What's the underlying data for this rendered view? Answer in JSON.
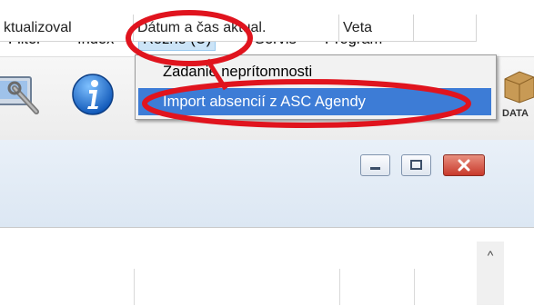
{
  "menubar": {
    "items": [
      {
        "label": "Filter"
      },
      {
        "label": "Index"
      },
      {
        "label": "Rôzne (U)"
      },
      {
        "label": "Servis"
      },
      {
        "label": "Program"
      }
    ]
  },
  "toolbar": {
    "data_label": "DATA"
  },
  "dropdown": {
    "items": [
      {
        "label": "Zadanie neprítomnosti"
      },
      {
        "label": "Import absencií z ASC Agendy"
      }
    ]
  },
  "table": {
    "columns": [
      "ktualizoval",
      "Dátum a čas aktual.",
      "Veta"
    ]
  },
  "scrollbar": {
    "up_glyph": "^"
  },
  "colors": {
    "highlight": "#3d7cd6",
    "annotation": "#e0141e",
    "close_button": "#d9463a"
  }
}
